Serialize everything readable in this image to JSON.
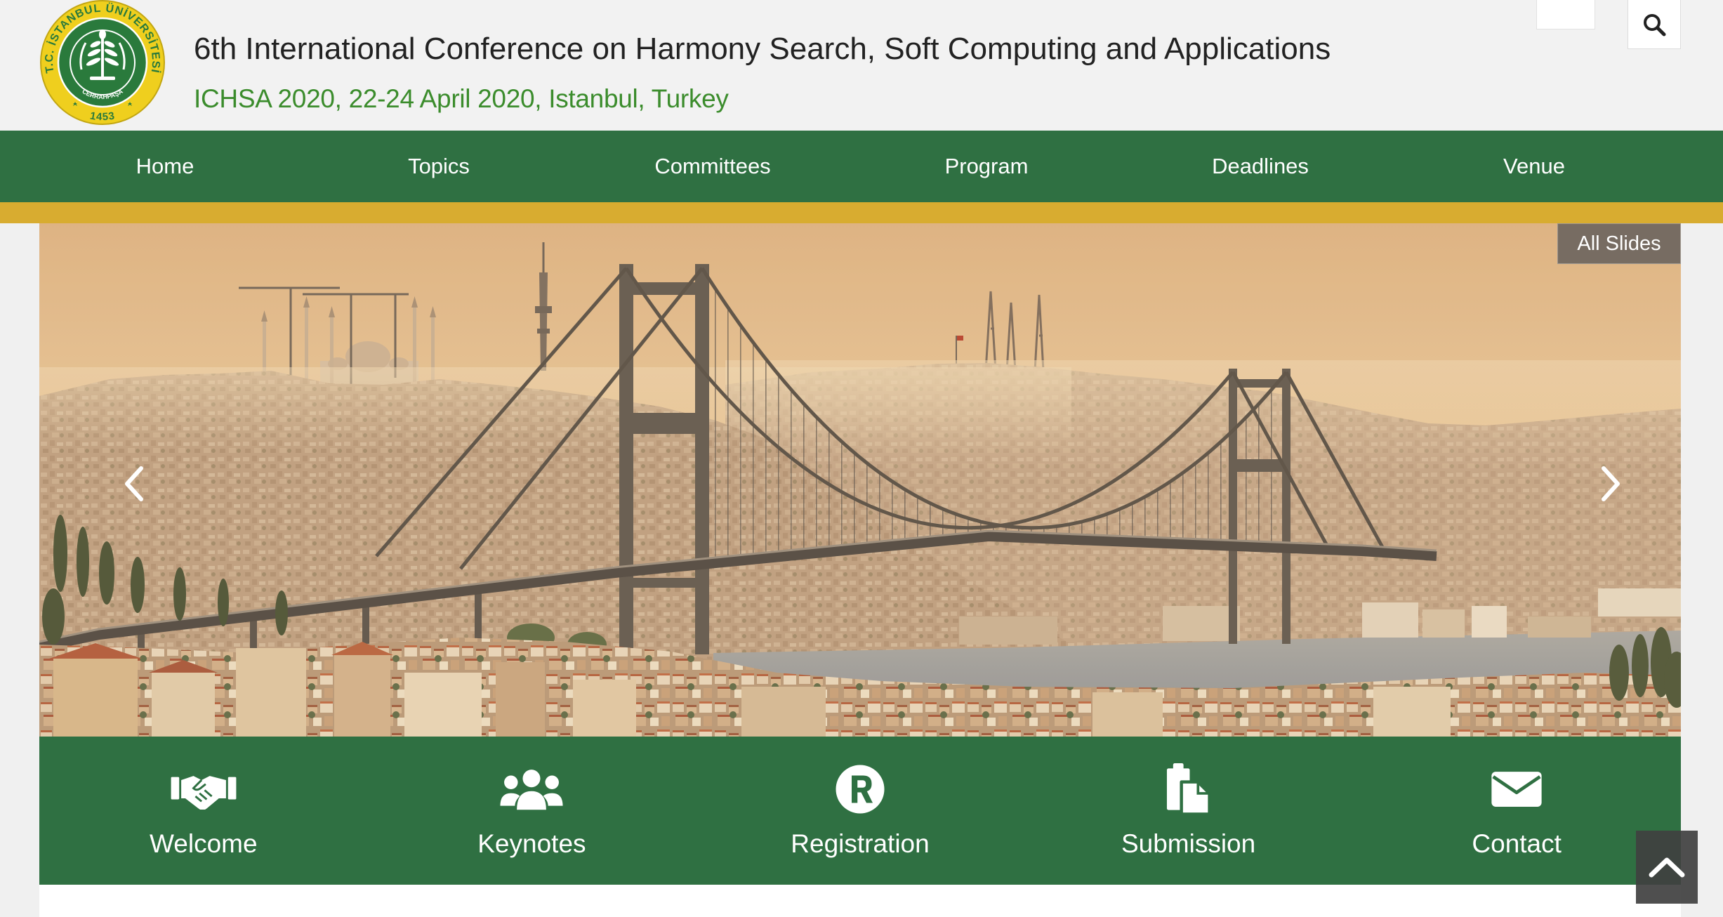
{
  "header": {
    "logo": {
      "ring_text": "T.C. İSTANBUL ÜNİVERSİTESİ",
      "year": "1453",
      "inner_text": "CERRAHPAŞA"
    },
    "title": "6th International Conference on Harmony Search, Soft Computing and Applications",
    "subtitle": "ICHSA 2020, 22-24 April 2020, Istanbul, Turkey",
    "search_icon": "search-icon"
  },
  "nav": {
    "items": [
      {
        "label": "Home"
      },
      {
        "label": "Topics"
      },
      {
        "label": "Committees"
      },
      {
        "label": "Program"
      },
      {
        "label": "Deadlines"
      },
      {
        "label": "Venue"
      }
    ]
  },
  "slider": {
    "all_slides_label": "All Slides",
    "prev_icon": "chevron-left-icon",
    "next_icon": "chevron-right-icon"
  },
  "quick_links": [
    {
      "label": "Welcome",
      "icon": "handshake-icon"
    },
    {
      "label": "Keynotes",
      "icon": "users-icon"
    },
    {
      "label": "Registration",
      "icon": "registered-icon"
    },
    {
      "label": "Submission",
      "icon": "files-icon"
    },
    {
      "label": "Contact",
      "icon": "envelope-icon"
    }
  ],
  "scroll_top": {
    "icon": "chevron-up-icon"
  },
  "colors": {
    "header_bg": "#f2f2f2",
    "nav_green": "#2f7042",
    "accent_gold": "#d8ac30",
    "subtitle_green": "#3b8c2c",
    "logo_yellow": "#efcf1e",
    "logo_green": "#2a7a3c"
  }
}
